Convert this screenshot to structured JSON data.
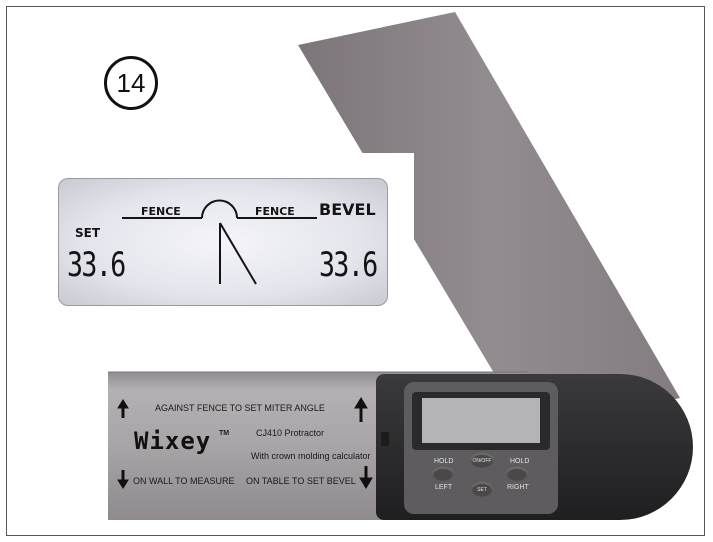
{
  "step_number": "14",
  "lcd_zoom": {
    "fence_left": "FENCE",
    "fence_right": "FENCE",
    "bevel_label": "BEVEL",
    "set_label": "SET",
    "value_left": "33.6",
    "value_right": "33.6"
  },
  "protractor": {
    "top_instruction": "AGAINST FENCE TO SET MITER ANGLE",
    "brand": "Wixey",
    "trademark": "TM",
    "model": "CJ410 Protractor",
    "feature": "With crown molding calculator",
    "bottom_left_instruction": "ON WALL TO MEASURE",
    "bottom_right_instruction": "ON TABLE TO SET BEVEL"
  },
  "device_buttons": {
    "onoff": "ON/OFF",
    "set": "SET",
    "hold_left_top": "HOLD",
    "hold_left_bottom": "LEFT",
    "hold_right_top": "HOLD",
    "hold_right_bottom": "RIGHT"
  },
  "colors": {
    "arm": "#8a8488",
    "base": "#9e9a9e",
    "device_body": "#2c2c2e",
    "lcd_bg": "#e8e8ef"
  }
}
